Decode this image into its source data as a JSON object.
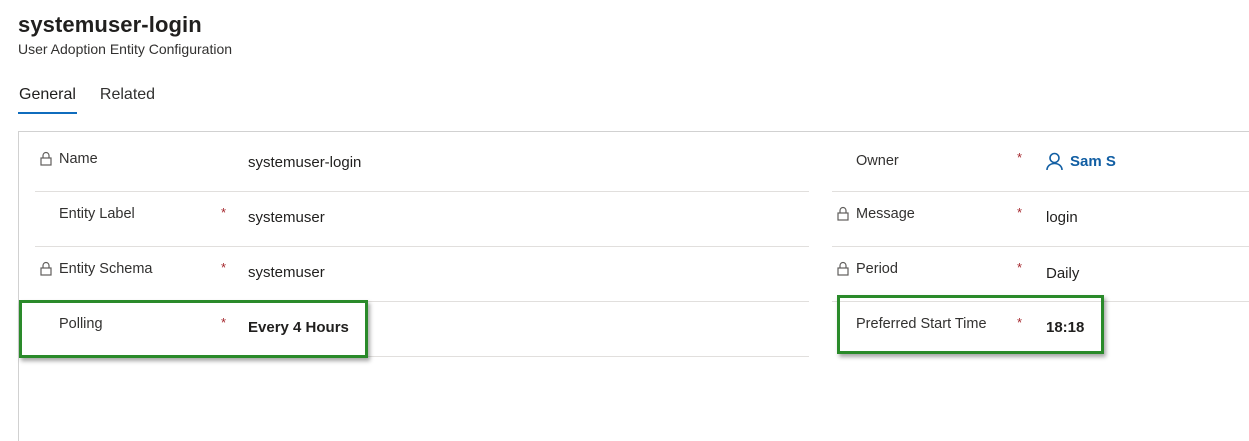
{
  "header": {
    "title": "systemuser-login",
    "subtitle": "User Adoption Entity Configuration"
  },
  "tabs": [
    {
      "label": "General",
      "active": true
    },
    {
      "label": "Related",
      "active": false
    }
  ],
  "left_fields": [
    {
      "label": "Name",
      "locked": true,
      "required": false,
      "value": "systemuser-login"
    },
    {
      "label": "Entity Label",
      "locked": false,
      "required": true,
      "value": "systemuser"
    },
    {
      "label": "Entity Schema",
      "locked": true,
      "required": true,
      "value": "systemuser"
    },
    {
      "label": "Polling",
      "locked": false,
      "required": true,
      "value": "Every 4 Hours"
    }
  ],
  "right_fields": [
    {
      "label": "Owner",
      "locked": false,
      "required": true,
      "value": "Sam S",
      "icon": "person-icon"
    },
    {
      "label": "Message",
      "locked": true,
      "required": true,
      "value": "login"
    },
    {
      "label": "Period",
      "locked": true,
      "required": true,
      "value": "Daily"
    },
    {
      "label": "Preferred Start Time",
      "locked": false,
      "required": true,
      "value": "18:18"
    }
  ],
  "required_marker": "*",
  "colors": {
    "accent": "#0f6cbd",
    "link": "#115ea3",
    "required": "#a4262c",
    "highlight": "#2a8a2a"
  }
}
